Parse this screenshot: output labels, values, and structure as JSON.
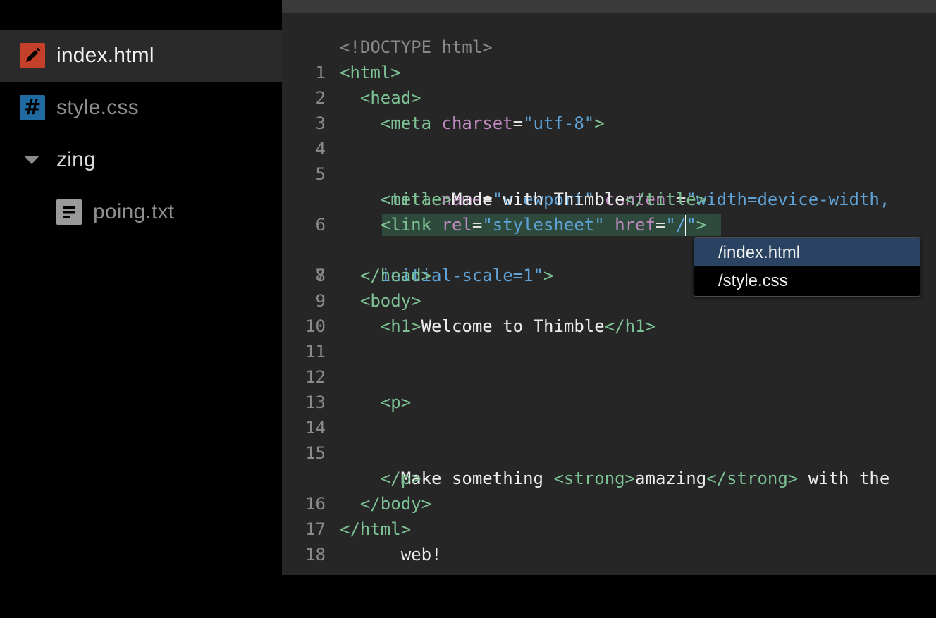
{
  "sidebar": {
    "files": [
      {
        "label": "index.html",
        "icon": "pencil-icon",
        "selected": true
      },
      {
        "label": "style.css",
        "icon": "hash-icon"
      },
      {
        "label": "zing",
        "icon": "caret-down-icon",
        "type": "folder"
      },
      {
        "label": "poing.txt",
        "icon": "document-lines-icon",
        "indent": 1
      }
    ]
  },
  "editor": {
    "line_numbers": [
      "1",
      "2",
      "3",
      "4",
      "5",
      "6",
      "7",
      "8",
      "9",
      "10",
      "11",
      "12",
      "13",
      "14",
      "15",
      "16",
      "17",
      "18"
    ],
    "lines": {
      "l1": [
        "<!DOCTYPE html>"
      ],
      "l2": [
        "<html>"
      ],
      "l3": [
        "  ",
        "<head>"
      ],
      "l4": [
        "    ",
        "<meta ",
        "charset",
        "=",
        "\"utf-8\"",
        ">"
      ],
      "l5a": [
        "    ",
        "<meta ",
        "name",
        "=",
        "\"viewport\"",
        " ",
        "content",
        "=",
        "\"width=device-width,"
      ],
      "l5b": [
        "    ",
        "initial-scale=1\"",
        ">"
      ],
      "l6": [
        "    ",
        "<title>",
        "Made with Thimble",
        "</title>"
      ],
      "l7": [
        "    ",
        "<link ",
        "rel",
        "=",
        "\"stylesheet\"",
        " ",
        "href",
        "=",
        "\"/",
        "\"",
        ">"
      ],
      "l8": [
        ""
      ],
      "l9": [
        "  ",
        "</head>"
      ],
      "l10": [
        "  ",
        "<body>"
      ],
      "l11": [
        "    ",
        "<h1>",
        "Welcome to Thimble",
        "</h1>"
      ],
      "l12": [
        ""
      ],
      "l13": [
        ""
      ],
      "l14": [
        "    ",
        "<p>"
      ],
      "l15a": [
        "      ",
        "Make something ",
        "<strong>",
        "amazing",
        "</strong>",
        " with the"
      ],
      "l15b": [
        "      ",
        "web!"
      ],
      "l16": [
        "    ",
        "</p>"
      ],
      "l17": [
        "  ",
        "</body>"
      ],
      "l18": [
        "</html>"
      ]
    }
  },
  "autocomplete": {
    "options": [
      "/index.html",
      "/style.css"
    ],
    "active_index": 0
  },
  "colors": {
    "tag": "#7dc294",
    "attribute": "#c08ac0",
    "string": "#5fa3d8",
    "text": "#ededed",
    "html_icon": "#c5402b",
    "css_icon": "#1f6aa0",
    "hint_active": "#2b4362"
  }
}
